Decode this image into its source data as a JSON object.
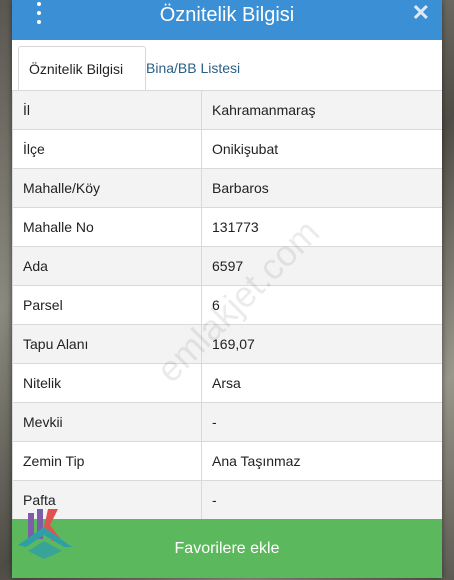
{
  "header": {
    "title": "Öznitelik Bilgisi",
    "close_glyph": "✕"
  },
  "tabs": [
    {
      "label": "Öznitelik Bilgisi",
      "active": true
    },
    {
      "label": "Bina/BB Listesi",
      "active": false
    }
  ],
  "rows": [
    {
      "key": "İl",
      "value": "Kahramanmaraş"
    },
    {
      "key": "İlçe",
      "value": "Onikişubat"
    },
    {
      "key": "Mahalle/Köy",
      "value": "Barbaros"
    },
    {
      "key": "Mahalle No",
      "value": "131773"
    },
    {
      "key": "Ada",
      "value": "6597"
    },
    {
      "key": "Parsel",
      "value": "6"
    },
    {
      "key": "Tapu Alanı",
      "value": "169,07"
    },
    {
      "key": "Nitelik",
      "value": "Arsa"
    },
    {
      "key": "Mevkii",
      "value": "-"
    },
    {
      "key": "Zemin Tip",
      "value": "Ana Taşınmaz"
    },
    {
      "key": "Pafta",
      "value": "-"
    }
  ],
  "footer": {
    "favorite_label": "Favorilere ekle"
  },
  "watermark": "emlakjet.com",
  "colors": {
    "header": "#3b8fd4",
    "favorite": "#5cb85c",
    "tab_inactive_text": "#2b5f86"
  }
}
